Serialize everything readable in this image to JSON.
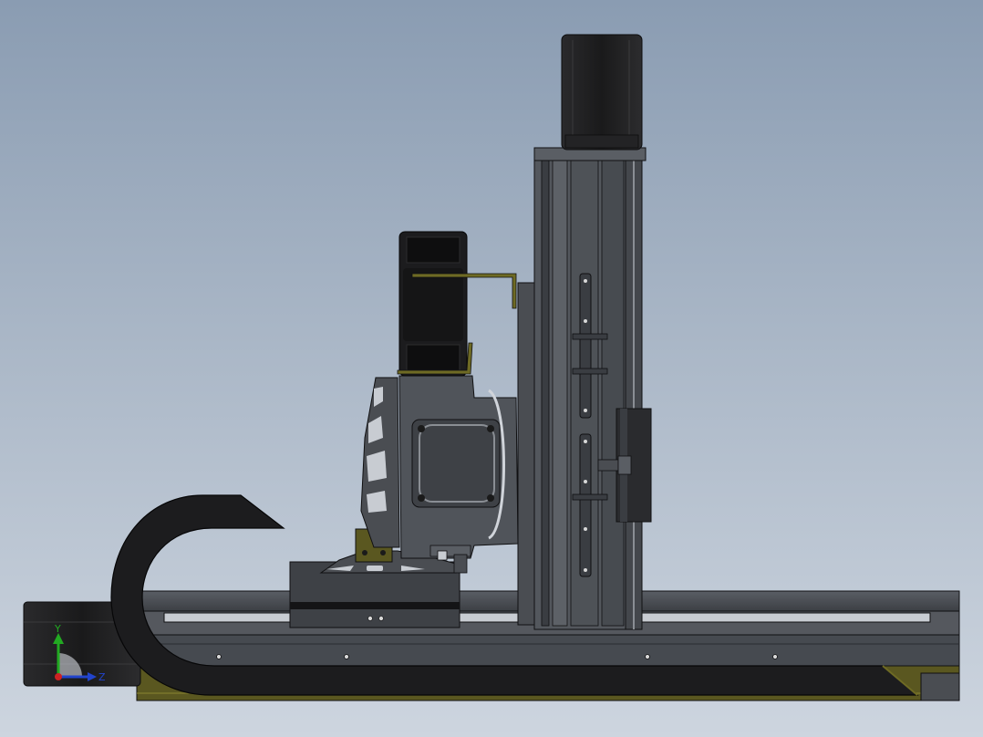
{
  "viewport": {
    "background_top": "#8a9cb2",
    "background_bottom": "#cdd5df"
  },
  "model": {
    "body_color": "#4a4d52",
    "dark_color": "#1c1c1e",
    "edge_color": "#101012",
    "accent_color": "#6e6a24"
  },
  "triad": {
    "y_label": "Y",
    "z_label": "Z",
    "y_color": "#22aa22",
    "z_color": "#2244cc",
    "x_color": "#cc2222"
  }
}
